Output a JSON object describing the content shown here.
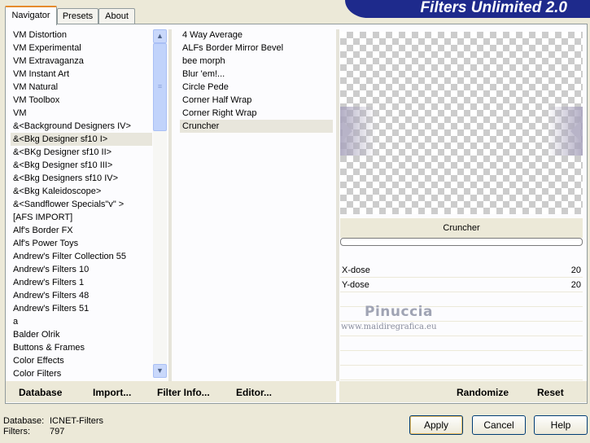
{
  "tabs": [
    {
      "label": "Navigator",
      "active": true
    },
    {
      "label": "Presets",
      "active": false
    },
    {
      "label": "About",
      "active": false
    }
  ],
  "banner": "Filters Unlimited 2.0",
  "categories": [
    {
      "label": "VM Distortion"
    },
    {
      "label": "VM Experimental"
    },
    {
      "label": "VM Extravaganza"
    },
    {
      "label": "VM Instant Art"
    },
    {
      "label": "VM Natural"
    },
    {
      "label": "VM Toolbox"
    },
    {
      "label": "VM"
    },
    {
      "label": "&<Background Designers IV>"
    },
    {
      "label": "&<Bkg Designer sf10 I>",
      "selected": true
    },
    {
      "label": "&<BKg Designer sf10 II>"
    },
    {
      "label": "&<Bkg Designer sf10 III>"
    },
    {
      "label": "&<Bkg Designers sf10 IV>"
    },
    {
      "label": "&<Bkg Kaleidoscope>"
    },
    {
      "label": "&<Sandflower Specials\"v\" >"
    },
    {
      "label": "[AFS IMPORT]"
    },
    {
      "label": "Alf's Border FX"
    },
    {
      "label": "Alf's Power Toys"
    },
    {
      "label": "Andrew's Filter Collection 55"
    },
    {
      "label": "Andrew's Filters 10"
    },
    {
      "label": "Andrew's Filters 1"
    },
    {
      "label": "Andrew's Filters 48"
    },
    {
      "label": "Andrew's Filters 51"
    },
    {
      "label": "a"
    },
    {
      "label": "Balder Olrik"
    },
    {
      "label": "Buttons & Frames"
    },
    {
      "label": "Color Effects"
    },
    {
      "label": "Color Filters"
    }
  ],
  "filters": [
    {
      "label": "4 Way Average"
    },
    {
      "label": "ALFs Border Mirror Bevel"
    },
    {
      "label": "bee morph"
    },
    {
      "label": "Blur 'em!..."
    },
    {
      "label": "Circle Pede"
    },
    {
      "label": "Corner Half Wrap"
    },
    {
      "label": "Corner Right Wrap"
    },
    {
      "label": "Cruncher",
      "selected": true
    }
  ],
  "preview": {
    "filter_name": "Cruncher",
    "progress": 0
  },
  "params": [
    {
      "label": "X-dose",
      "value": "20"
    },
    {
      "label": "Y-dose",
      "value": "20"
    }
  ],
  "watermark": {
    "line1": "Pinuccia",
    "line2": "www.maidiregrafica.eu"
  },
  "toolbar": {
    "database": "Database",
    "import": "Import...",
    "filter_info": "Filter Info...",
    "editor": "Editor...",
    "randomize": "Randomize",
    "reset": "Reset"
  },
  "status": {
    "database_label": "Database:",
    "database_value": "ICNET-Filters",
    "filters_label": "Filters:",
    "filters_value": "797"
  },
  "buttons": {
    "apply": "Apply",
    "cancel": "Cancel",
    "help": "Help"
  },
  "colors": {
    "banner_bg": "#1e2a8c",
    "window_bg": "#ece9d8",
    "tab_accent": "#e68b2c"
  }
}
